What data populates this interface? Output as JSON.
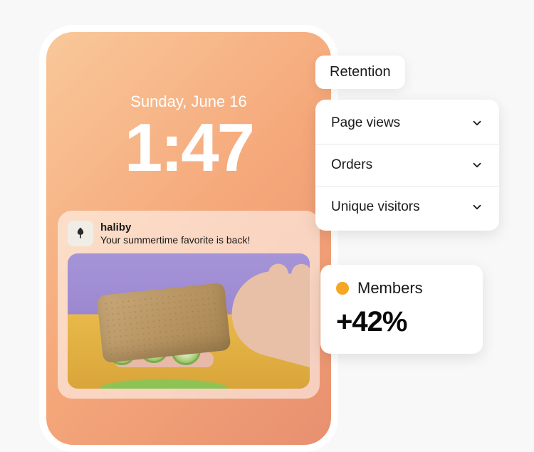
{
  "lockscreen": {
    "date": "Sunday, June 16",
    "time": "1:47"
  },
  "notification": {
    "app_name": "haliby",
    "message": "Your summertime favorite is back!"
  },
  "retention_label": "Retention",
  "metrics": {
    "page_views": "Page views",
    "orders": "Orders",
    "unique_visitors": "Unique visitors"
  },
  "members_card": {
    "label": "Members",
    "value": "+42%",
    "dot_color": "#f5a623"
  }
}
